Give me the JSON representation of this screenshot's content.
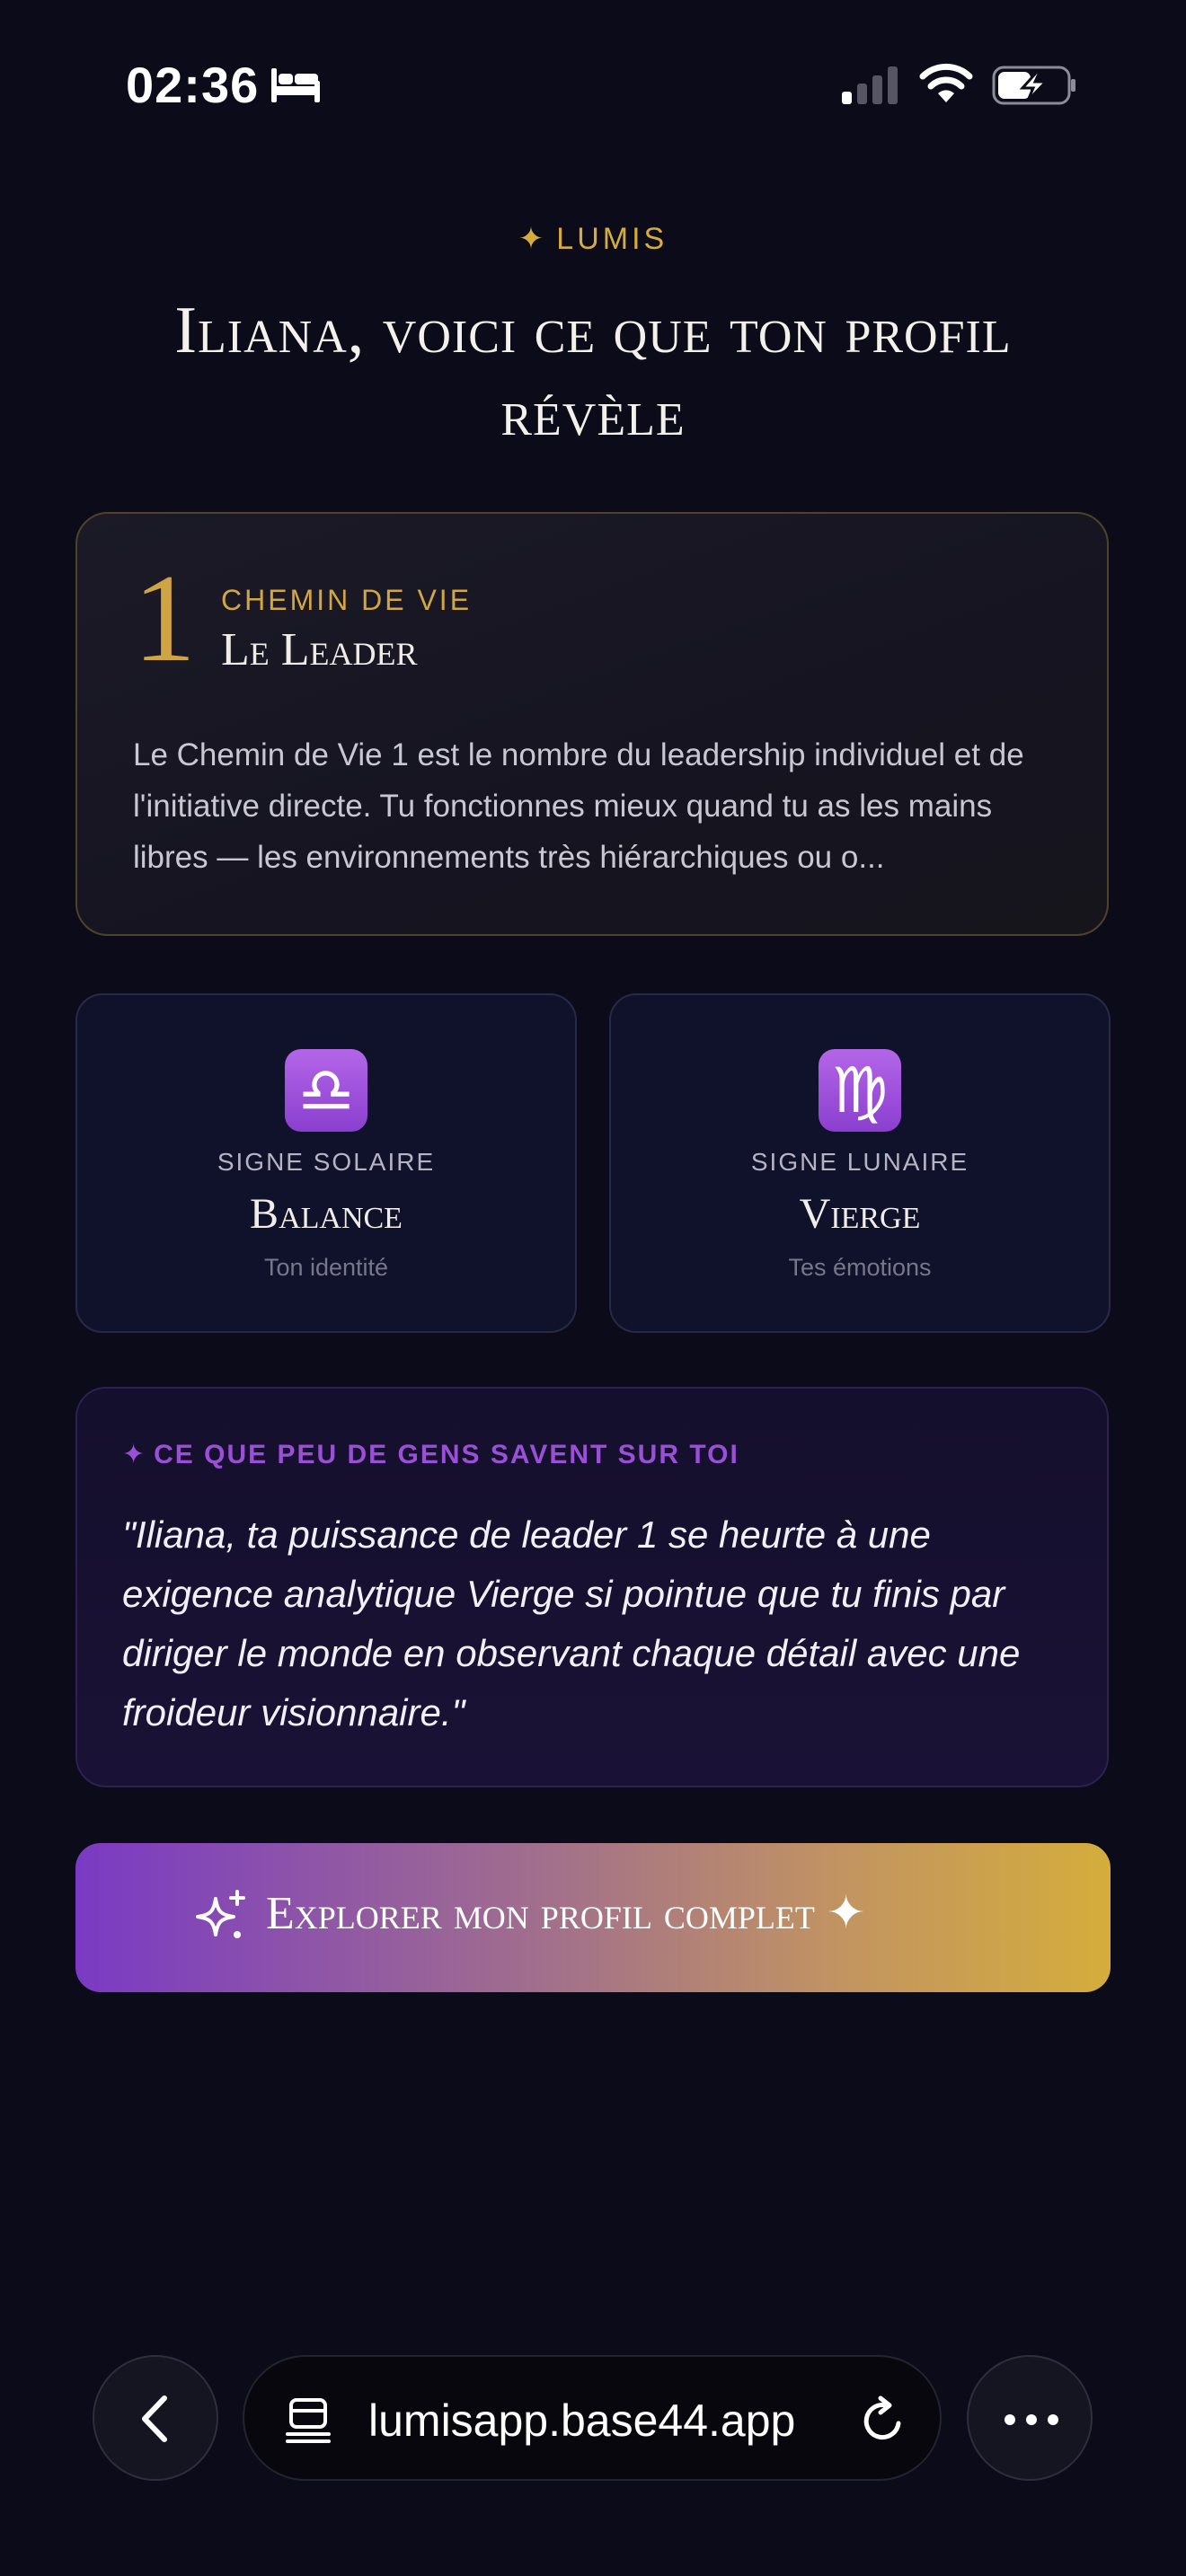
{
  "status_bar": {
    "time": "02:36",
    "icons": [
      "bed-icon",
      "cellular-signal-icon",
      "wifi-icon",
      "battery-charging-icon"
    ]
  },
  "header": {
    "brand_star": "✦",
    "brand": "LUMIS",
    "title": "Iliana, voici ce que ton profil révèle"
  },
  "life_path": {
    "number": "1",
    "label": "CHEMIN DE VIE",
    "title": "Le Leader",
    "description": "Le Chemin de Vie 1 est le nombre du leadership individuel et de l'initiative directe. Tu fonctionnes mieux quand tu as les mains libres — les environnements très hiérarchiques ou o..."
  },
  "signs": {
    "solar": {
      "symbol": "♎",
      "kind": "SIGNE SOLAIRE",
      "name": "Balance",
      "subtitle": "Ton identité",
      "icon": "libra-icon"
    },
    "lunar": {
      "symbol": "♍",
      "kind": "SIGNE LUNAIRE",
      "name": "Vierge",
      "subtitle": "Tes émotions",
      "icon": "virgo-icon"
    }
  },
  "secret": {
    "star": "✦",
    "label": "CE QUE PEU DE GENS SAVENT SUR TOI",
    "quote": "\"Iliana, ta puissance de leader 1 se heurte à une exigence analytique Vierge si pointue que tu finis par diriger le monde en observant chaque détail avec une froideur visionnaire.\""
  },
  "cta": {
    "label": "Explorer mon profil complet ✦",
    "icon": "sparkles-icon"
  },
  "browser": {
    "url": "lumisapp.base44.app",
    "icons": [
      "back-icon",
      "page-icon",
      "reload-icon",
      "more-icon"
    ]
  },
  "colors": {
    "background": "#0b0b19",
    "gold": "#d6ac3d",
    "purple": "#9a4fd6",
    "cta_start": "#7a3ac4",
    "cta_end": "#d4ad3c"
  }
}
